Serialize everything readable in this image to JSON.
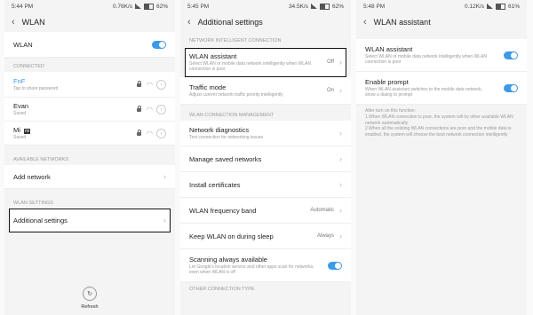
{
  "panel1": {
    "status": {
      "time": "5:44 PM",
      "speed": "0.76K/s",
      "battery": "62%"
    },
    "title": "WLAN",
    "wlan_label": "WLAN",
    "connected_header": "CONNECTED",
    "networks": [
      {
        "name": "FnF",
        "sub": "Tap to share password",
        "name_color": "#3d9ae8"
      },
      {
        "name": "Evan",
        "sub": "Saved",
        "name_color": "#222222"
      },
      {
        "name": "Mi",
        "badge": "mi",
        "sub": "Saved",
        "name_color": "#222222"
      }
    ],
    "available_header": "AVAILABLE NETWORKS",
    "add_network": "Add network",
    "settings_header": "WLAN SETTINGS",
    "additional_settings": "Additional settings",
    "refresh_label": "Refresh"
  },
  "panel2": {
    "status": {
      "time": "5:45 PM",
      "speed": "34.5K/s",
      "battery": "62%"
    },
    "title": "Additional settings",
    "section1": "NETWORK INTELLIGENT CONNECTION",
    "wlan_assistant": {
      "title": "WLAN assistant",
      "sub": "Select WLAN or mobile data network intelligently when WLAN connection is poor",
      "value": "Off"
    },
    "traffic_mode": {
      "title": "Traffic mode",
      "sub": "Adjust current network traffic priority intelligently",
      "value": "On"
    },
    "section2": "WLAN CONNECTION MANAGEMENT",
    "diagnostics": {
      "title": "Network diagnostics",
      "sub": "Test connection for networking issues"
    },
    "manage_saved": "Manage saved networks",
    "install_certs": "Install certificates",
    "freq_band": {
      "title": "WLAN frequency band",
      "value": "Automatic"
    },
    "keep_wlan": {
      "title": "Keep WLAN on during sleep",
      "value": "Always"
    },
    "scanning": {
      "title": "Scanning always available",
      "sub": "Let Google's location service and other apps scan for networks, even when WLAN is off"
    },
    "section3": "OTHER CONNECTION TYPE"
  },
  "panel3": {
    "status": {
      "time": "5:48 PM",
      "speed": "0.12K/s",
      "battery": "61%"
    },
    "title": "WLAN assistant",
    "assistant": {
      "title": "WLAN assistant",
      "sub": "Select WLAN or mobile data network intelligently when WLAN connection is poor"
    },
    "prompt": {
      "title": "Enable prompt",
      "sub": "When WLAN assistant switches to the mobile data network, show a dialog to prompt"
    },
    "description": "After turn on this function:\n1.When WLAN connection is poor, the system will try other available WLAN network automatically\n2.When all the existing WLAN connections are poor and the mobile data is enabled, the system will choose the best network connection intelligently"
  },
  "colors": {
    "accent": "#3d9ae8"
  }
}
